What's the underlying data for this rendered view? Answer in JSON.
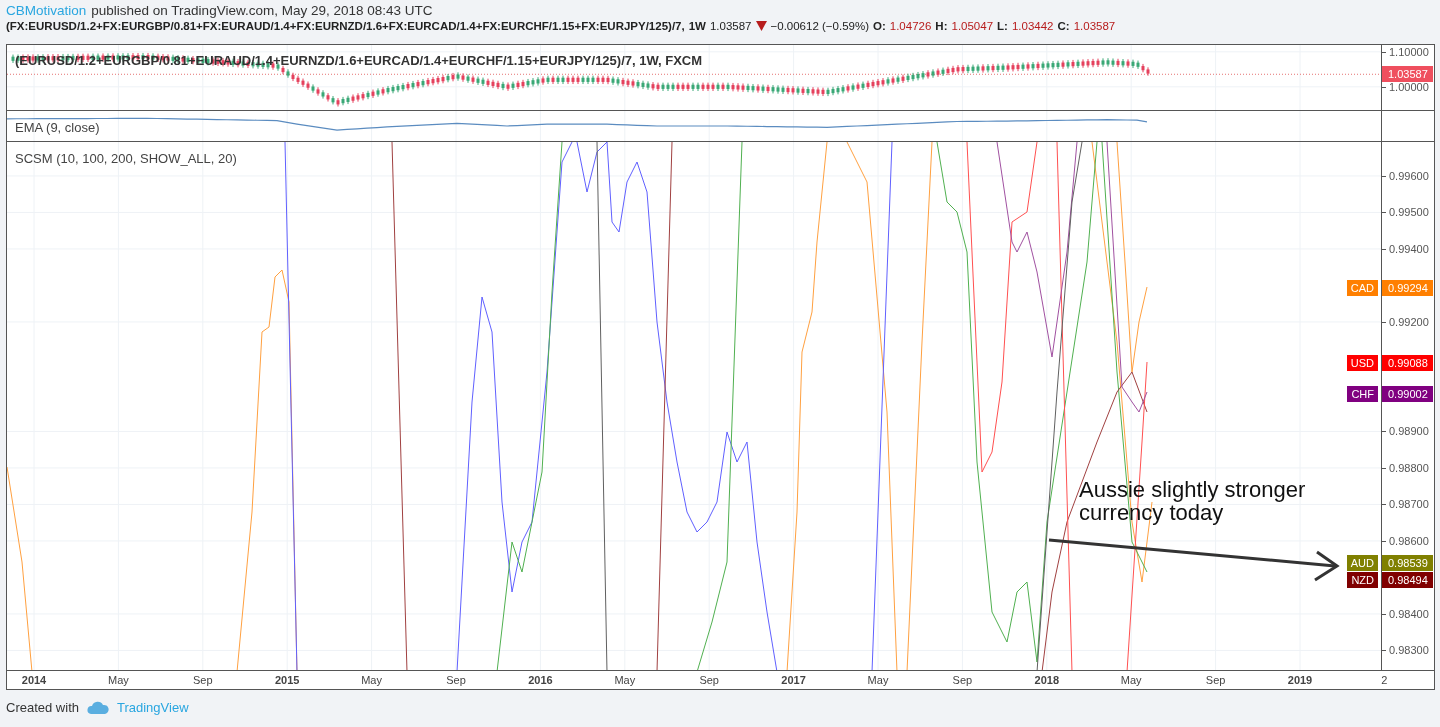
{
  "header": {
    "author": "CBMotivation",
    "published": "published on TradingView.com, May 29, 2018 08:43 UTC",
    "symbol": "(FX:EURUSD/1.2+FX:EURGBP/0.81+FX:EURAUD/1.4+FX:EURNZD/1.6+FX:EURCAD/1.4+FX:EURCHF/1.15+FX:EURJPY/125)/7,",
    "interval": "1W",
    "last": "1.03587",
    "change": "−0.00612 (−0.59%)",
    "ohlc": [
      {
        "label": "O:",
        "value": "1.04726"
      },
      {
        "label": "H:",
        "value": "1.05047"
      },
      {
        "label": "L:",
        "value": "1.03442"
      },
      {
        "label": "C:",
        "value": "1.03587"
      }
    ]
  },
  "main_pane": {
    "legend": "(EURUSD/1.2+EURGBP/0.81+EURAUD/1.4+EURNZD/1.6+EURCAD/1.4+EURCHF/1.15+EURJPY/125)/7, 1W, FXCM",
    "price_axis": [
      "1.10000",
      "1.00000"
    ],
    "last_price": "1.03587"
  },
  "ema_pane": {
    "legend": "EMA (9, close)"
  },
  "scsm_pane": {
    "legend": "SCSM (10, 100, 200, SHOW_ALL, 20)",
    "price_axis": [
      "0.99600",
      "0.99500",
      "0.99400",
      "0.99200",
      "0.98900",
      "0.98800",
      "0.98700",
      "0.98600",
      "0.98400",
      "0.98300"
    ],
    "currency_labels": [
      {
        "currency": "CAD",
        "value": "0.99294",
        "color": "#ff7f00"
      },
      {
        "currency": "USD",
        "value": "0.99088",
        "color": "#ff0000"
      },
      {
        "currency": "CHF",
        "value": "0.99002",
        "color": "#800080"
      },
      {
        "currency": "AUD",
        "value": "0.98539",
        "color": "#808000"
      },
      {
        "currency": "NZD",
        "value": "0.98494",
        "color": "#800000"
      }
    ],
    "annotation": "Aussie slightly stronger currency today"
  },
  "time_axis": [
    {
      "label": "2014",
      "kind": "year"
    },
    {
      "label": "May",
      "kind": "month"
    },
    {
      "label": "Sep",
      "kind": "month"
    },
    {
      "label": "2015",
      "kind": "year"
    },
    {
      "label": "May",
      "kind": "month"
    },
    {
      "label": "Sep",
      "kind": "month"
    },
    {
      "label": "2016",
      "kind": "year"
    },
    {
      "label": "May",
      "kind": "month"
    },
    {
      "label": "Sep",
      "kind": "month"
    },
    {
      "label": "2017",
      "kind": "year"
    },
    {
      "label": "May",
      "kind": "month"
    },
    {
      "label": "Sep",
      "kind": "month"
    },
    {
      "label": "2018",
      "kind": "year"
    },
    {
      "label": "May",
      "kind": "month"
    },
    {
      "label": "Sep",
      "kind": "month"
    },
    {
      "label": "2019",
      "kind": "year"
    },
    {
      "label": "2",
      "kind": "month"
    }
  ],
  "footer": {
    "created": "Created with",
    "brand": "TradingView"
  }
}
